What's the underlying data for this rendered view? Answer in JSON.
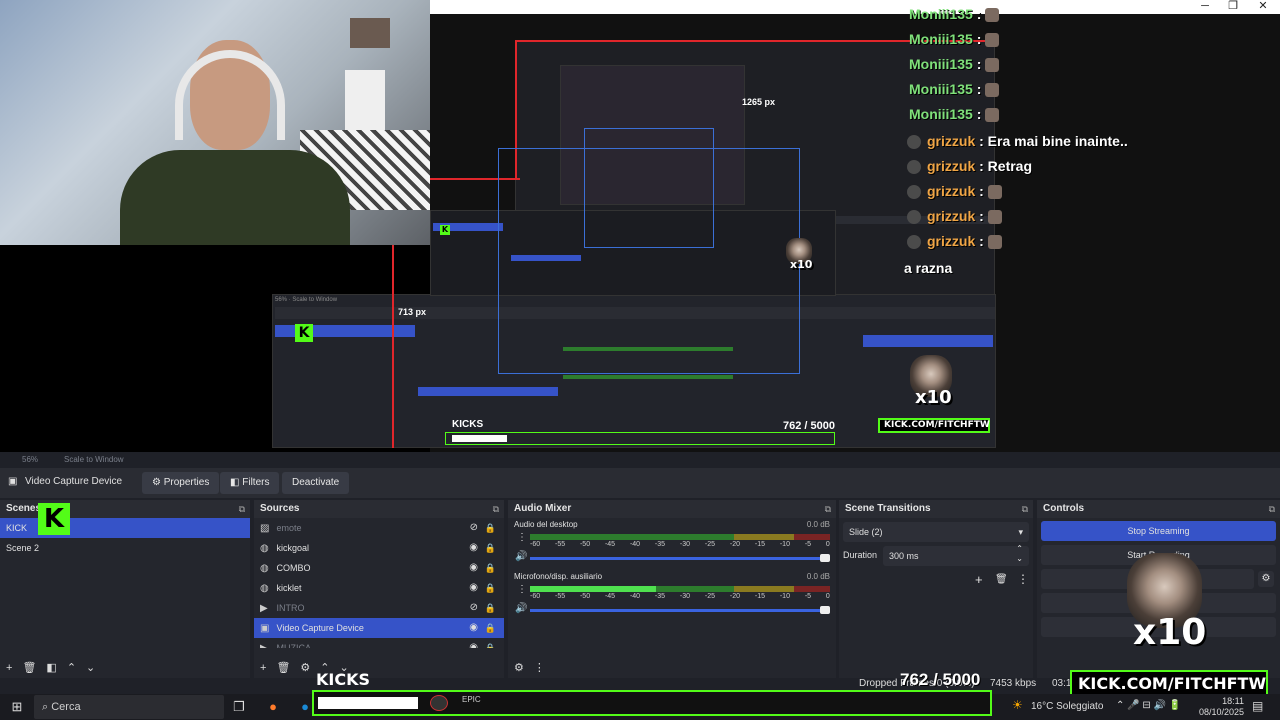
{
  "window": {
    "minimize": "─",
    "restore": "❐",
    "close": "✕"
  },
  "chat": {
    "top_messages": [
      {
        "user": "Moniii135",
        "sep": ":"
      },
      {
        "user": "Moniii135",
        "sep": ":"
      },
      {
        "user": "Moniii135",
        "sep": ":"
      },
      {
        "user": "Moniii135",
        "sep": ":"
      },
      {
        "user": "Moniii135",
        "sep": ":"
      }
    ],
    "messages": [
      {
        "user": "grizzuk",
        "text": ": Era mai bine inainte.."
      },
      {
        "user": "grizzuk",
        "text": ": Retrag"
      },
      {
        "user": "grizzuk",
        "text": ":"
      },
      {
        "user": "grizzuk",
        "text": ":"
      },
      {
        "user": "grizzuk",
        "text": ":"
      }
    ],
    "trailing": "a razna"
  },
  "preview_labels": {
    "px_width": "1265 px",
    "px_height": "713 px"
  },
  "statusbar": {
    "zoom": "56%",
    "scale_mode": "Scale to Window"
  },
  "toolbar": {
    "source_name": "Video Capture Device",
    "properties": "Properties",
    "filters": "Filters",
    "deactivate": "Deactivate"
  },
  "scenes": {
    "title": "Scenes",
    "items": [
      "KICK",
      "Scene 2"
    ]
  },
  "sources": {
    "title": "Sources",
    "items": [
      {
        "name": "emote",
        "icon": "image-icon"
      },
      {
        "name": "kickgoal",
        "icon": "browser-icon"
      },
      {
        "name": "COMBO",
        "icon": "browser-icon"
      },
      {
        "name": "kicklet",
        "icon": "browser-icon"
      },
      {
        "name": "INTRO",
        "icon": "media-icon"
      },
      {
        "name": "Video Capture Device",
        "icon": "camera-icon"
      },
      {
        "name": "MUZICA",
        "icon": "media-icon"
      }
    ]
  },
  "audio": {
    "title": "Audio Mixer",
    "channels": [
      {
        "name": "Audio del desktop",
        "db": "0.0 dB",
        "level": 0.0
      },
      {
        "name": "Microfono/disp. ausiliario",
        "db": "0.0 dB",
        "level": 0.42
      }
    ],
    "ticks": [
      "-60",
      "-55",
      "-50",
      "-45",
      "-40",
      "-35",
      "-30",
      "-25",
      "-20",
      "-15",
      "-10",
      "-5",
      "0"
    ]
  },
  "transitions": {
    "title": "Scene Transitions",
    "selected": "Slide (2)",
    "duration_label": "Duration",
    "duration_value": "300 ms"
  },
  "controls": {
    "title": "Controls",
    "stop_streaming": "Stop Streaming",
    "start_recording": "Start Recording",
    "start_virtual": "Start"
  },
  "overlays": {
    "kicks_label": "KICKS",
    "goal": "762 / 5000",
    "kick_url": "KICK.COM/FITCHFTW",
    "multiplier": "x10",
    "dropped_frames": "Dropped Frames 0 (0.0%)",
    "bitrate": "7453 kbps",
    "time_code": "03:1"
  },
  "taskbar": {
    "search_placeholder": "Cerca",
    "weather": "16°C  Soleggiato",
    "time": "18:11",
    "date": "08/10/2025"
  },
  "colors": {
    "kick_green": "#53fc18",
    "obs_selection": "#3653c8",
    "obs_bg": "#1f2128"
  }
}
